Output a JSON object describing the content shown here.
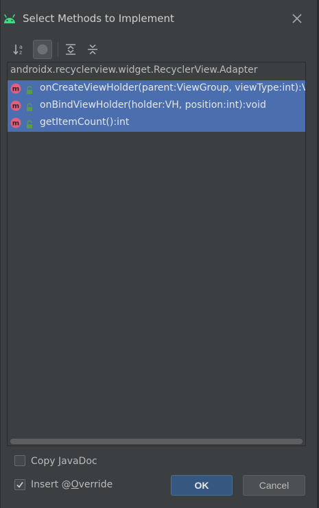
{
  "window": {
    "title": "Select Methods to Implement",
    "app_icon": "android-icon",
    "close_icon": "close-icon"
  },
  "toolbar": {
    "buttons": [
      {
        "name": "sort-alphabetically-icon",
        "toggled": false
      },
      {
        "name": "show-classes-icon",
        "toggled": true
      },
      {
        "name": "expand-all-icon",
        "toggled": false
      },
      {
        "name": "collapse-all-icon",
        "toggled": false
      }
    ]
  },
  "tree": {
    "group": "androidx.recyclerview.widget.RecyclerView.Adapter",
    "methods": [
      {
        "label": "onCreateViewHolder(parent:ViewGroup, viewType:int):VH",
        "selected": true
      },
      {
        "label": "onBindViewHolder(holder:VH, position:int):void",
        "selected": true
      },
      {
        "label": "getItemCount():int",
        "selected": true
      }
    ],
    "selection_color": "#4b6eaf",
    "method_icon": "method-icon",
    "visibility_icon": "lock-icon"
  },
  "options": {
    "copy_javadoc": {
      "prefix": "Copy ",
      "mnemonic": "J",
      "suffix": "avaDoc",
      "checked": false
    },
    "insert_override": {
      "prefix": "Insert @",
      "mnemonic": "O",
      "suffix": "verride",
      "checked": true
    }
  },
  "buttons": {
    "ok": "OK",
    "cancel": "Cancel"
  },
  "colors": {
    "background": "#3c3f41",
    "primary_button": "#365880",
    "android_green": "#3ddc84",
    "method_badge": "#e0607e"
  }
}
